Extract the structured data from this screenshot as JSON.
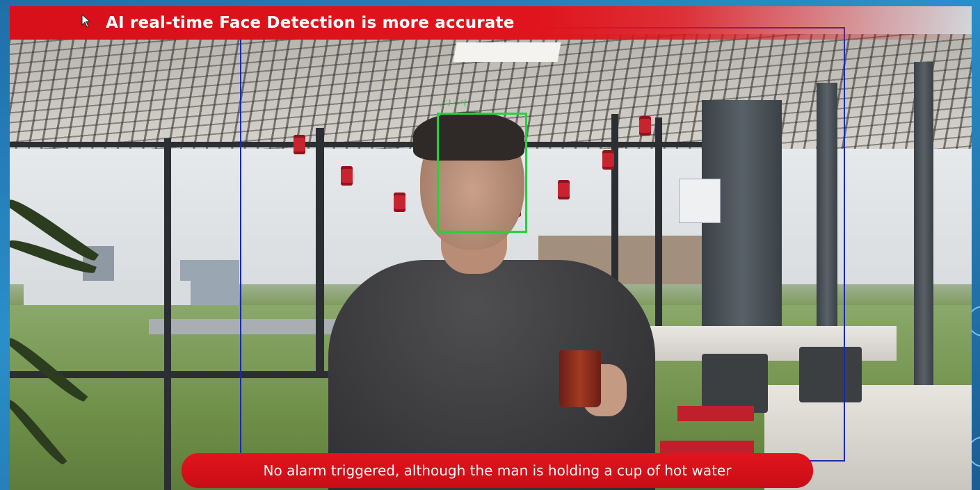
{
  "banner": {
    "title": "AI real-time Face Detection is more accurate"
  },
  "caption": {
    "text": "No alarm triggered, although the man is holding  a cup of hot water"
  },
  "overlays": {
    "face_box_color": "#22d43a",
    "person_box_color": "#1a2aa8"
  },
  "colors": {
    "banner_red": "#e0141c",
    "slide_blue": "#2a8fc9"
  },
  "icons": [
    "mouse-cursor-icon"
  ]
}
